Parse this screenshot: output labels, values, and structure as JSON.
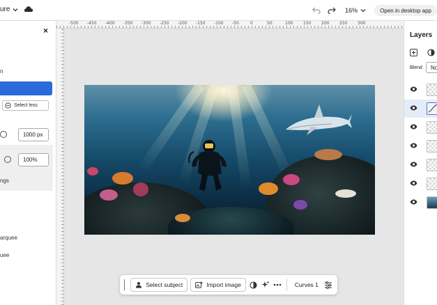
{
  "topbar": {
    "doc_title_fragment": "ure",
    "zoom": "16%",
    "open_desktop_label": "Open in desktop app"
  },
  "left_panel": {
    "fragment_1": "n",
    "select_less_label": "Select less",
    "size_value": "1000 px",
    "percent_value": "100%",
    "fragment_settings": "ngs",
    "fragment_marquee_1": "arquee",
    "fragment_marquee_2": "uee"
  },
  "ruler": {
    "ticks": [
      "-500",
      "-450",
      "-400",
      "-350",
      "-300",
      "-250",
      "-200",
      "-150",
      "-100",
      "-50",
      "0",
      "50",
      "100",
      "150",
      "200",
      "250",
      "300"
    ]
  },
  "bottom_toolbar": {
    "select_subject_label": "Select subject",
    "import_image_label": "Import image",
    "curves_label": "Curves 1"
  },
  "right_panel": {
    "title": "Layers",
    "blend_label": "Blend",
    "blend_value": "No",
    "layers": [
      {
        "type": "mask"
      },
      {
        "type": "curve"
      },
      {
        "type": "empty"
      },
      {
        "type": "mask"
      },
      {
        "type": "mask"
      },
      {
        "type": "empty"
      },
      {
        "type": "photo"
      }
    ]
  },
  "colors": {
    "accent": "#2a6ad9",
    "selected_row": "#e4ecf8"
  }
}
